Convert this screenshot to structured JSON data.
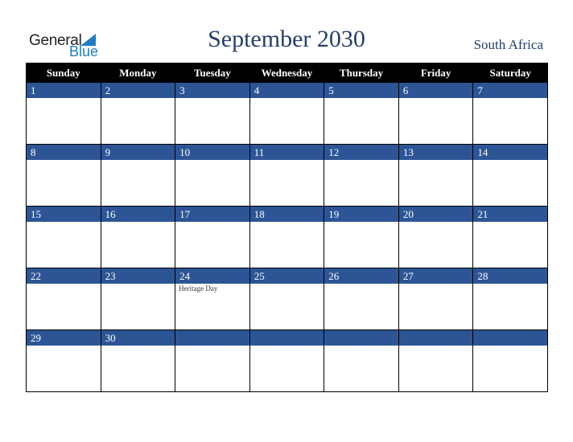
{
  "logo": {
    "line1": "General",
    "line2": "Blue"
  },
  "header": {
    "title": "September 2030",
    "country": "South Africa"
  },
  "weekdays": [
    "Sunday",
    "Monday",
    "Tuesday",
    "Wednesday",
    "Thursday",
    "Friday",
    "Saturday"
  ],
  "weeks": [
    [
      {
        "day": "1"
      },
      {
        "day": "2"
      },
      {
        "day": "3"
      },
      {
        "day": "4"
      },
      {
        "day": "5"
      },
      {
        "day": "6"
      },
      {
        "day": "7"
      }
    ],
    [
      {
        "day": "8"
      },
      {
        "day": "9"
      },
      {
        "day": "10"
      },
      {
        "day": "11"
      },
      {
        "day": "12"
      },
      {
        "day": "13"
      },
      {
        "day": "14"
      }
    ],
    [
      {
        "day": "15"
      },
      {
        "day": "16"
      },
      {
        "day": "17"
      },
      {
        "day": "18"
      },
      {
        "day": "19"
      },
      {
        "day": "20"
      },
      {
        "day": "21"
      }
    ],
    [
      {
        "day": "22"
      },
      {
        "day": "23"
      },
      {
        "day": "24",
        "holiday": "Heritage Day"
      },
      {
        "day": "25"
      },
      {
        "day": "26"
      },
      {
        "day": "27"
      },
      {
        "day": "28"
      }
    ],
    [
      {
        "day": "29"
      },
      {
        "day": "30"
      },
      {
        "day": ""
      },
      {
        "day": ""
      },
      {
        "day": ""
      },
      {
        "day": ""
      },
      {
        "day": ""
      }
    ]
  ],
  "colors": {
    "header_bg": "#000000",
    "day_band": "#2d5596",
    "title": "#243f6b",
    "logo_blue": "#1f7dc3"
  }
}
